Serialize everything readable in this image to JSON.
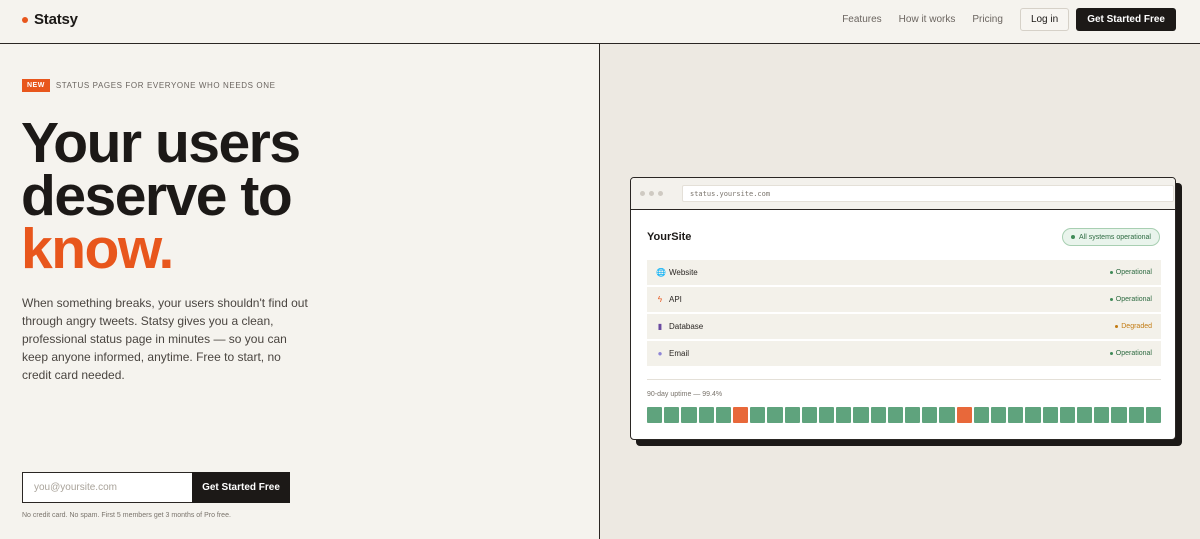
{
  "header": {
    "logo": "Statsy",
    "nav": [
      "Features",
      "How it works",
      "Pricing"
    ],
    "login": "Log in",
    "cta": "Get Started Free"
  },
  "hero": {
    "badge": "NEW",
    "eyebrow": "STATUS PAGES FOR EVERYONE WHO NEEDS ONE",
    "headline_1": "Your users",
    "headline_2": "deserve to",
    "headline_accent": "know.",
    "subtext": "When something breaks, your users shouldn't find out through angry tweets. Statsy gives you a clean, professional status page in minutes — so you can keep anyone informed, anytime. Free to start, no credit card needed.",
    "email_placeholder": "you@yoursite.com",
    "signup_button": "Get Started Free",
    "fineprint": "No credit card. No spam. First 5 members get 3 months of Pro free."
  },
  "mockup": {
    "url": "status.yoursite.com",
    "site_name": "YourSite",
    "overall_status": "All systems operational",
    "services": [
      {
        "name": "Website",
        "icon": "globe-icon",
        "status": "Operational",
        "state": "operational"
      },
      {
        "name": "API",
        "icon": "lightning-icon",
        "status": "Operational",
        "state": "operational"
      },
      {
        "name": "Database",
        "icon": "database-icon",
        "status": "Degraded",
        "state": "degraded"
      },
      {
        "name": "Email",
        "icon": "email-icon",
        "status": "Operational",
        "state": "operational"
      }
    ],
    "uptime_label": "90-day uptime — 99.4%",
    "uptime_days": [
      "up",
      "up",
      "up",
      "up",
      "up",
      "down",
      "up",
      "up",
      "up",
      "up",
      "up",
      "up",
      "up",
      "up",
      "up",
      "up",
      "up",
      "up",
      "down",
      "up",
      "up",
      "up",
      "up",
      "up",
      "up",
      "up",
      "up",
      "up",
      "up",
      "up"
    ]
  },
  "colors": {
    "accent": "#e8561c",
    "operational": "#5fa37d",
    "incident": "#e8683a",
    "degraded": "#c27b12",
    "dark": "#1c1917"
  }
}
